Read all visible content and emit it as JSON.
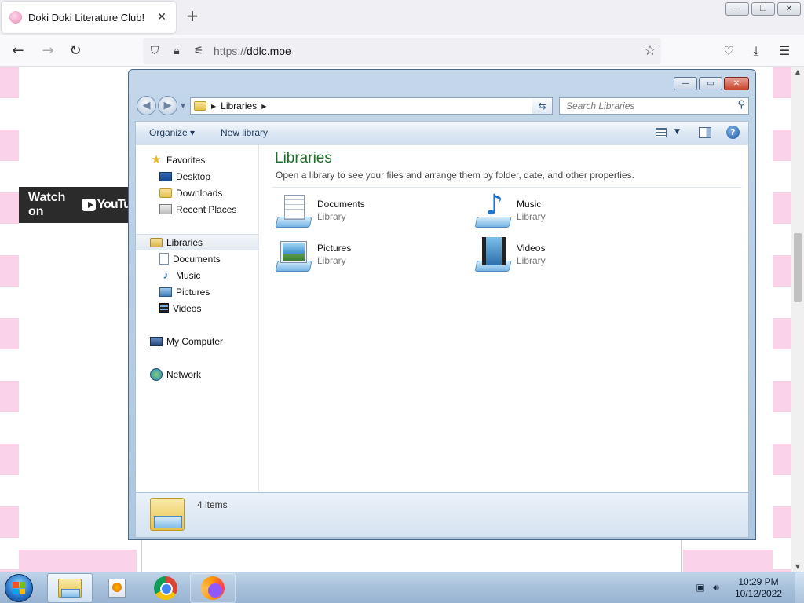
{
  "browser": {
    "tab_title": "Doki Doki Literature Club!",
    "tab_close": "✕",
    "new_tab": "+",
    "url_scheme": "https://",
    "url_host": "ddlc.moe",
    "window_buttons": [
      "—",
      "❐",
      "✕"
    ]
  },
  "webpage": {
    "video_watch_label": "Watch on",
    "video_brand": "YouTu"
  },
  "explorer": {
    "title_buttons": [
      "—",
      "▭",
      "✕"
    ],
    "breadcrumb": "Libraries",
    "search_placeholder": "Search Libraries",
    "commands": {
      "organize": "Organize ▾",
      "new_library": "New library"
    },
    "nav": {
      "favorites": "Favorites",
      "desktop": "Desktop",
      "downloads": "Downloads",
      "recent_places": "Recent Places",
      "libraries": "Libraries",
      "documents": "Documents",
      "music": "Music",
      "pictures": "Pictures",
      "videos": "Videos",
      "my_computer": "My Computer",
      "network": "Network"
    },
    "content": {
      "title": "Libraries",
      "subtitle": "Open a library to see your files and arrange them by folder, date, and other properties.",
      "items": [
        {
          "name": "Documents",
          "type": "Library",
          "icon": "documents-library-icon"
        },
        {
          "name": "Music",
          "type": "Library",
          "icon": "music-library-icon"
        },
        {
          "name": "Pictures",
          "type": "Library",
          "icon": "pictures-library-icon"
        },
        {
          "name": "Videos",
          "type": "Library",
          "icon": "videos-library-icon"
        }
      ]
    },
    "status": {
      "count": "4 items"
    }
  },
  "taskbar": {
    "clock_time": "10:29 PM",
    "clock_date": "10/12/2022"
  },
  "colors": {
    "library_title_green": "#1e6e2a",
    "ddlc_pink": "#fbd3e8",
    "taskbar_blue": "#a9c2dc"
  }
}
